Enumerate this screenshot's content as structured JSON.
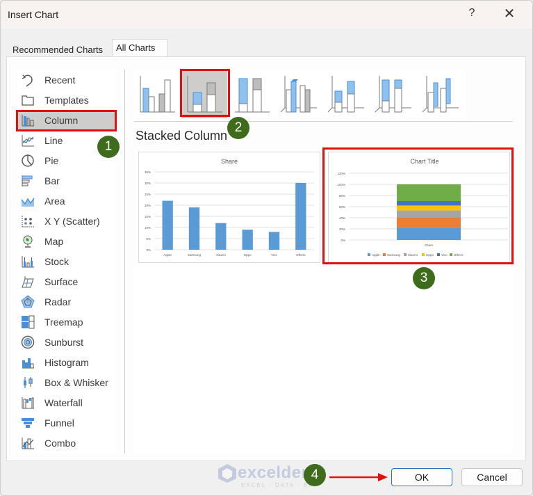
{
  "window": {
    "title": "Insert Chart",
    "help_label": "?",
    "close_label": "✕"
  },
  "tabs": [
    {
      "label": "Recommended Charts",
      "active": false
    },
    {
      "label": "All Charts",
      "active": true
    }
  ],
  "sidebar": {
    "selected": "Column",
    "items": [
      {
        "label": "Recent",
        "icon": "recent-icon"
      },
      {
        "label": "Templates",
        "icon": "templates-icon"
      },
      {
        "label": "Column",
        "icon": "column-chart-icon"
      },
      {
        "label": "Line",
        "icon": "line-chart-icon"
      },
      {
        "label": "Pie",
        "icon": "pie-chart-icon"
      },
      {
        "label": "Bar",
        "icon": "bar-chart-icon"
      },
      {
        "label": "Area",
        "icon": "area-chart-icon"
      },
      {
        "label": "X Y (Scatter)",
        "icon": "scatter-chart-icon"
      },
      {
        "label": "Map",
        "icon": "map-chart-icon"
      },
      {
        "label": "Stock",
        "icon": "stock-chart-icon"
      },
      {
        "label": "Surface",
        "icon": "surface-chart-icon"
      },
      {
        "label": "Radar",
        "icon": "radar-chart-icon"
      },
      {
        "label": "Treemap",
        "icon": "treemap-chart-icon"
      },
      {
        "label": "Sunburst",
        "icon": "sunburst-chart-icon"
      },
      {
        "label": "Histogram",
        "icon": "histogram-chart-icon"
      },
      {
        "label": "Box & Whisker",
        "icon": "box-whisker-chart-icon"
      },
      {
        "label": "Waterfall",
        "icon": "waterfall-chart-icon"
      },
      {
        "label": "Funnel",
        "icon": "funnel-chart-icon"
      },
      {
        "label": "Combo",
        "icon": "combo-chart-icon"
      }
    ]
  },
  "subtypes": {
    "selected_index": 1,
    "items": [
      {
        "name": "Clustered Column"
      },
      {
        "name": "Stacked Column"
      },
      {
        "name": "100% Stacked Column"
      },
      {
        "name": "3-D Clustered Column"
      },
      {
        "name": "3-D Stacked Column"
      },
      {
        "name": "3-D 100% Stacked Column"
      },
      {
        "name": "3-D Column"
      }
    ],
    "selected_title": "Stacked Column"
  },
  "annotations": {
    "step1": "1",
    "step2": "2",
    "step3": "3",
    "step4": "4",
    "accent_red": "#e01010",
    "badge_green": "#3e6b1c"
  },
  "buttons": {
    "ok": "OK",
    "cancel": "Cancel"
  },
  "watermark": {
    "text": "exceldemy",
    "subtext": "EXCEL · DATA · BI"
  },
  "chart_data": [
    {
      "type": "bar",
      "title": "Share",
      "categories": [
        "Apple",
        "Samsung",
        "Xiaomi",
        "Oppo",
        "Vivo",
        "Others"
      ],
      "values": [
        22,
        19,
        12,
        9,
        8,
        30
      ],
      "yticks": [
        "0%",
        "5%",
        "10%",
        "15%",
        "20%",
        "25%",
        "30%",
        "35%"
      ],
      "ylim": [
        0,
        35
      ],
      "xlabel": "",
      "ylabel": "",
      "color": "#5b9bd5",
      "grid": true
    },
    {
      "type": "bar",
      "stacked": true,
      "title": "Chart Title",
      "categories": [
        "Share"
      ],
      "series": [
        {
          "name": "Apple",
          "values": [
            22
          ],
          "color": "#5b9bd5"
        },
        {
          "name": "Samsung",
          "values": [
            19
          ],
          "color": "#ed7d31"
        },
        {
          "name": "Xiaomi",
          "values": [
            12
          ],
          "color": "#a5a5a5"
        },
        {
          "name": "Oppo",
          "values": [
            9
          ],
          "color": "#ffc000"
        },
        {
          "name": "Vivo",
          "values": [
            8
          ],
          "color": "#4472c4"
        },
        {
          "name": "Others",
          "values": [
            30
          ],
          "color": "#70ad47"
        }
      ],
      "yticks": [
        "0%",
        "20%",
        "40%",
        "60%",
        "80%",
        "100%",
        "120%"
      ],
      "ylim": [
        0,
        120
      ],
      "legend": "bottom",
      "grid": true
    }
  ]
}
